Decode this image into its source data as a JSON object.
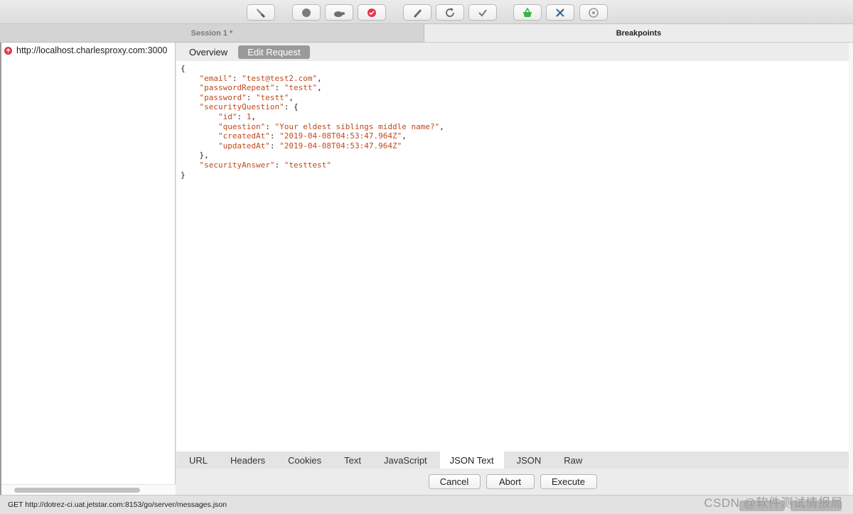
{
  "toolbar": {
    "icons": [
      "broom-icon",
      "record-icon",
      "turtle-icon",
      "breakpoint-icon",
      "pen-icon",
      "refresh-icon",
      "check-icon",
      "basket-icon",
      "tools-icon",
      "settings-icon"
    ]
  },
  "tabs": {
    "session": "Session 1 *",
    "breakpoints": "Breakpoints"
  },
  "left": {
    "request_url": "http://localhost.charlesproxy.com:3000"
  },
  "editor": {
    "subtabs": [
      "Overview",
      "Edit Request"
    ],
    "lines": [
      "{",
      "    \"email\": \"test@test2.com\",",
      "    \"passwordRepeat\": \"testt\",",
      "    \"password\": \"testt\",",
      "    \"securityQuestion\": {",
      "        \"id\": 1,",
      "        \"question\": \"Your eldest siblings middle name?\",",
      "        \"createdAt\": \"2019-04-08T04:53:47.964Z\",",
      "        \"updatedAt\": \"2019-04-08T04:53:47.964Z\"",
      "    },",
      "    \"securityAnswer\": \"testtest\"",
      "}"
    ]
  },
  "view_tabs": [
    "URL",
    "Headers",
    "Cookies",
    "Text",
    "JavaScript",
    "JSON Text",
    "JSON",
    "Raw"
  ],
  "actions": {
    "cancel": "Cancel",
    "abort": "Abort",
    "execute": "Execute"
  },
  "status": {
    "text": "GET http://dotrez-ci.uat.jetstar.com:8153/go/server/messages.json"
  },
  "watermark": "CSDN @软件测试情报局"
}
